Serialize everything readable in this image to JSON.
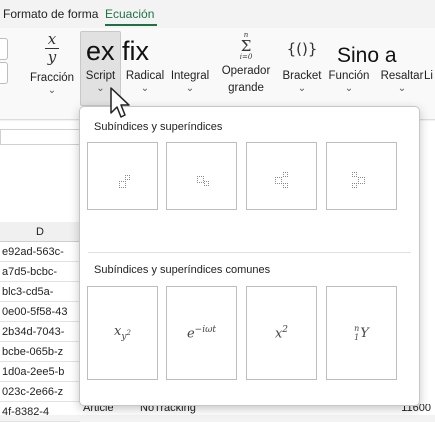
{
  "tabs": [
    {
      "label": "Formato de forma",
      "active": false
    },
    {
      "label": "Ecuación",
      "active": true
    }
  ],
  "ribbon": {
    "fraction": {
      "label": "Fracción",
      "icon_top": "x",
      "icon_bottom": "y"
    },
    "script": {
      "label": "Script",
      "overlay": "ex fix"
    },
    "radical": {
      "label": "Radical"
    },
    "integral": {
      "label": "Integral"
    },
    "large_operator": {
      "label_line1": "Operador",
      "label_line2": "grande",
      "icon_top": "n",
      "icon_mid": "Σ",
      "icon_bottom": "i=0"
    },
    "bracket": {
      "label": "Bracket",
      "icon": "{()}"
    },
    "function": {
      "label": "Función",
      "overlay": "Sino a"
    },
    "accent": {
      "label": "Resaltar"
    },
    "limit": {
      "label": "Li"
    }
  },
  "sheet": {
    "column_header": "D",
    "rows": [
      "e92ad-563c-",
      "a7d5-bcbc-",
      "blc3-cd5a-",
      "0e00-5f58-43",
      "2b34d-7043-",
      "bcbe-065b-z",
      "1d0a-2ee5-b",
      "023c-2e66-z",
      "4f-8382-4"
    ],
    "bottom_cells": {
      "type": "Article",
      "tracking": "NoTracking",
      "number": "11600"
    }
  },
  "dropdown": {
    "section1_title": "Subíndices y superíndices",
    "section2_title": "Subíndices y superíndices comunes",
    "common_examples": [
      {
        "base": "x",
        "sub": "y",
        "sup": "2"
      },
      {
        "base": "e",
        "sup": "−iωt"
      },
      {
        "base": "x",
        "sup": "2"
      },
      {
        "presup": "n",
        "presub": "1",
        "base": "Y"
      }
    ]
  },
  "colors": {
    "accent": "#1e7145"
  }
}
